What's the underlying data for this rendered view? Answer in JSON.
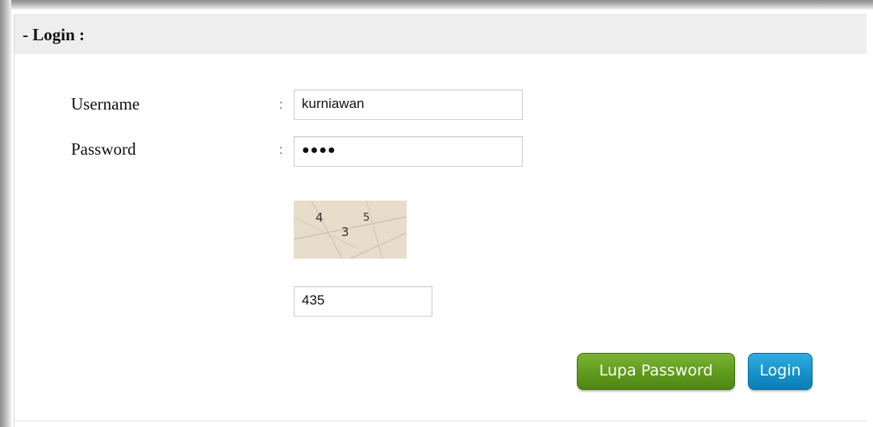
{
  "panel": {
    "title": "- Login :"
  },
  "form": {
    "username_label": "Username",
    "username_colon": ":",
    "username_value": "kurniawan",
    "password_label": "Password",
    "password_colon": ":",
    "password_masked": "●●●●",
    "captcha_digits": [
      "4",
      "3",
      "5"
    ],
    "captcha_answer": "435"
  },
  "buttons": {
    "forgot_password": "Lupa Password",
    "login": "Login"
  },
  "colors": {
    "header_bg": "#eeeeee",
    "forgot_button": "#5e9a1c",
    "login_button": "#1692c9",
    "captcha_bg": "#e8dccb"
  }
}
